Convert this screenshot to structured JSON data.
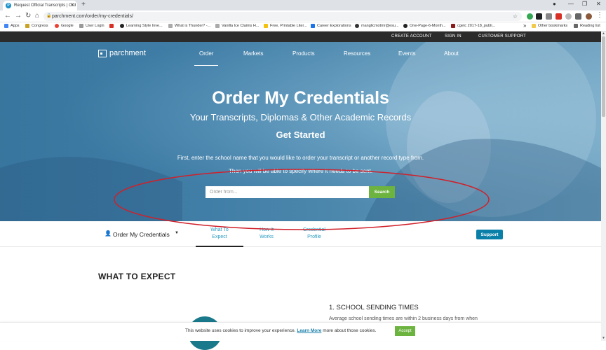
{
  "browser": {
    "tab_title": "Request Official Transcripts | Ord",
    "tab_favicon_letter": "P",
    "url": "parchment.com/order/my-credentials/",
    "bookmarks": [
      "Apps",
      "Congress",
      "Google",
      "User Login",
      "",
      "Learning Style Inve...",
      "What is Thunder? -...",
      "Vanilla Ice Claims H...",
      "Free, Printable Liter...",
      "Career Explorations",
      "manglicmotmr@esu...",
      "One-Page-6-Month...",
      "cgetc 2017-18_publi..."
    ],
    "other_bookmarks": "Other bookmarks",
    "reading_list": "Reading list"
  },
  "site": {
    "top_links": [
      "CREATE ACCOUNT",
      "SIGN IN",
      "CUSTOMER SUPPORT"
    ],
    "logo_text": "parchment",
    "nav": [
      "Order",
      "Markets",
      "Products",
      "Resources",
      "Events",
      "About"
    ],
    "hero": {
      "title": "Order My Credentials",
      "subtitle": "Your Transcripts, Diplomas & Other Academic Records",
      "get_started": "Get Started",
      "instruction_1": "First, enter the school name that you would like to order your transcript or another record type from.",
      "instruction_2": "Then you will be able to specify where it needs to be sent.",
      "search_placeholder": "Order from...",
      "search_button": "Search"
    },
    "subnav": {
      "menu_label": "Order My Credentials",
      "tabs": [
        {
          "line1": "What To",
          "line2": "Expect"
        },
        {
          "line1": "How It",
          "line2": "Works"
        },
        {
          "line1": "Credential",
          "line2": "Profile"
        }
      ],
      "support_button": "Support"
    },
    "content": {
      "heading": "WHAT TO EXPECT",
      "step_title": "1. SCHOOL SENDING TIMES",
      "step_text": "Average school sending times are within 2 business days from when"
    },
    "cookie": {
      "text_before": "This website uses cookies to improve your experience.",
      "link": "Learn More",
      "text_after": "more about those cookies.",
      "accept": "Accept"
    }
  },
  "colors": {
    "accent_green": "#6cb33f",
    "support_blue": "#0a7fa8",
    "annotation_red": "#d0202a"
  }
}
